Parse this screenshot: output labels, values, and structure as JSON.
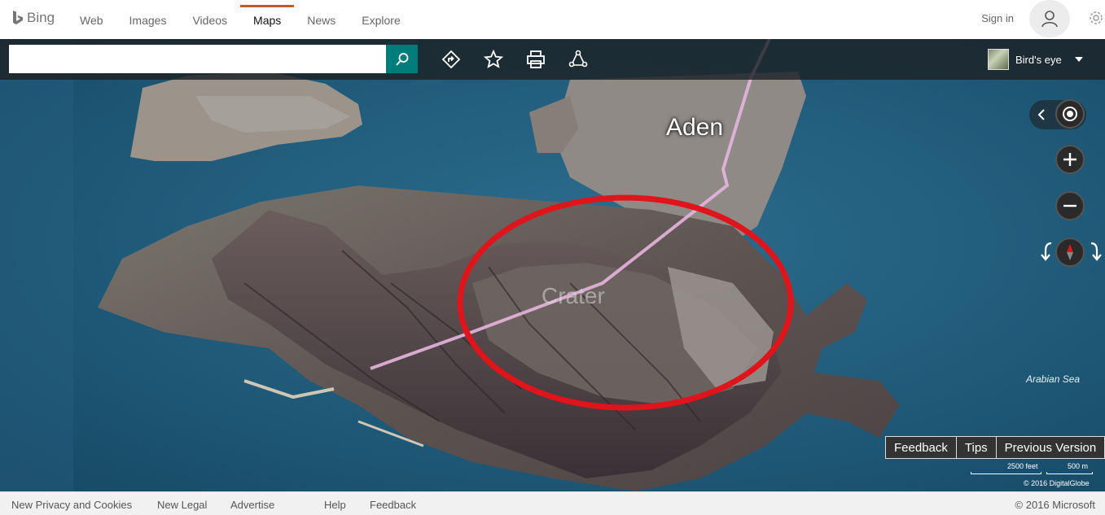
{
  "header": {
    "logo_text": "Bing",
    "nav": [
      "Web",
      "Images",
      "Videos",
      "Maps",
      "News",
      "Explore"
    ],
    "active_nav": "Maps",
    "signin_label": "Sign in",
    "accent_color": "#c8552f"
  },
  "toolbar": {
    "search_value": "",
    "search_placeholder": "",
    "icons": [
      "search-icon",
      "directions-icon",
      "favorites-icon",
      "print-icon",
      "share-icon"
    ],
    "view_label": "Bird's eye",
    "search_button_color": "#007d7a"
  },
  "map": {
    "labels": {
      "city": "Aden",
      "district": "Crater",
      "sea": "Arabian Sea"
    },
    "buttons": [
      "Feedback",
      "Tips",
      "Previous Version"
    ],
    "scale": {
      "imperial": "2500 feet",
      "metric": "500 m"
    },
    "copyright": "© 2016 DigitalGlobe",
    "annotation_color": "#e0141b",
    "route_color": "#e6b5dd"
  },
  "footer": {
    "links": [
      "New Privacy and Cookies",
      "New Legal",
      "Advertise",
      "Help",
      "Feedback"
    ],
    "copyright": "© 2016 Microsoft"
  }
}
